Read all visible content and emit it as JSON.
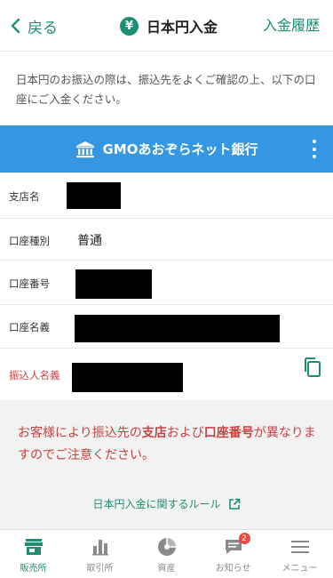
{
  "header": {
    "back_label": "戻る",
    "title_icon": "¥",
    "title": "日本円入金",
    "history_label": "入金履歴"
  },
  "notice": "日本円のお振込の際は、振込先をよくご確認の上、以下の口座にご入金ください。",
  "bank": {
    "name": "GMOあおぞらネット銀行",
    "icon": "bank-icon"
  },
  "account": {
    "branch_label": "支店名",
    "type_label": "口座種別",
    "type_value": "普通",
    "number_label": "口座番号",
    "holder_label": "口座名義",
    "depositor_label": "振込人名義"
  },
  "warning": {
    "part1": "お客様により振込先の",
    "bold1": "支店",
    "part2": "および",
    "bold2": "口座番号",
    "part3": "が異なりますのでご注意ください。"
  },
  "rule_link": "日本円入金に関するルール",
  "tabs": [
    {
      "label": "販売所",
      "icon": "store-icon",
      "active": true
    },
    {
      "label": "取引所",
      "icon": "bar-chart-icon",
      "active": false
    },
    {
      "label": "資産",
      "icon": "pie-chart-icon",
      "active": false
    },
    {
      "label": "お知らせ",
      "icon": "message-icon",
      "active": false,
      "badge": "2"
    },
    {
      "label": "メニュー",
      "icon": "menu-icon",
      "active": false
    }
  ],
  "colors": {
    "accent": "#1c8f73",
    "bank_bar": "#3597e4",
    "warning_text": "#c94141",
    "badge": "#e74c3c"
  }
}
